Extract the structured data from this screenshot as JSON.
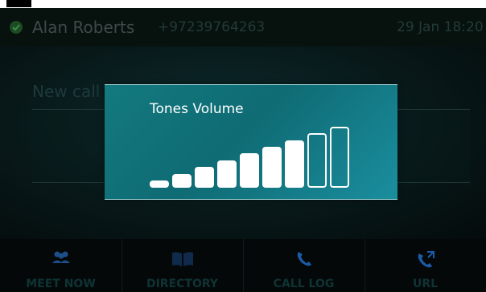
{
  "status_bar": {
    "user_name": "Alan Roberts",
    "phone_number": "+97239764263",
    "date_time": "29 Jan 18:20",
    "status_icon": "check-icon"
  },
  "main": {
    "new_call_label": "New call",
    "input_value": ""
  },
  "volume_overlay": {
    "title": "Tones Volume",
    "level": 8,
    "max_level": 9
  },
  "bottom_nav": {
    "items": [
      {
        "label": "MEET NOW",
        "icon": "people-icon"
      },
      {
        "label": "DIRECTORY",
        "icon": "book-icon"
      },
      {
        "label": "CALL LOG",
        "icon": "phone-icon"
      },
      {
        "label": "URL",
        "icon": "phone-forward-icon"
      }
    ]
  },
  "colors": {
    "accent": "#137a7e",
    "text_dim": "#3d4a47"
  }
}
